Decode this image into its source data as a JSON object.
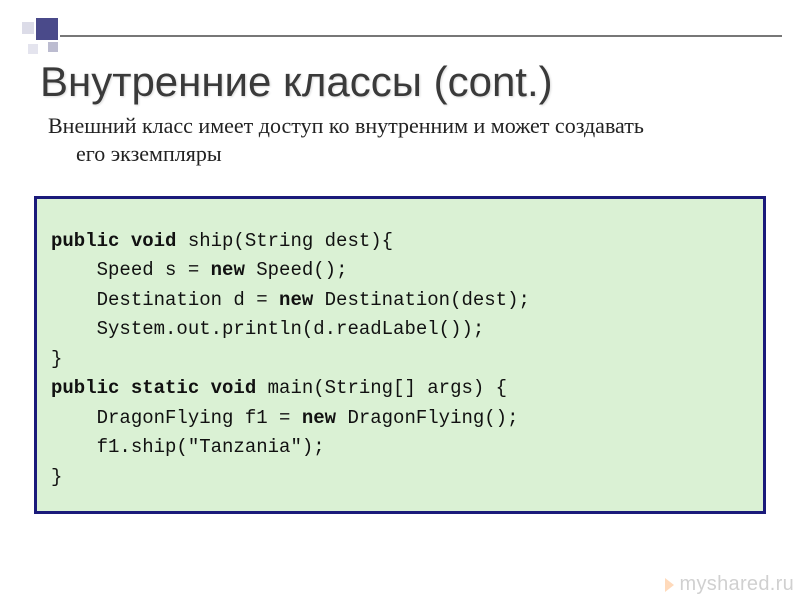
{
  "title": "Внутренние классы (cont.)",
  "subtitle_line1": "Внешний класс имеет доступ ко внутренним и может создавать",
  "subtitle_line2": "его экземпляры",
  "code": {
    "l1_kw": "public void ",
    "l1_rest": "ship(String dest){",
    "l2a": "    Speed s = ",
    "l2kw": "new ",
    "l2b": "Speed();",
    "l3a": "    Destination d = ",
    "l3kw": "new ",
    "l3b": "Destination(dest);",
    "l4": "    System.out.println(d.readLabel());",
    "l5": "}",
    "l6_kw": "public static void ",
    "l6_rest": "main(String[] args) {",
    "l7a": "    DragonFlying f1 = ",
    "l7kw": "new ",
    "l7b": "DragonFlying();",
    "l8": "    f1.ship(\"Tanzania\");",
    "l9": "}"
  },
  "watermark": "myshared.ru"
}
